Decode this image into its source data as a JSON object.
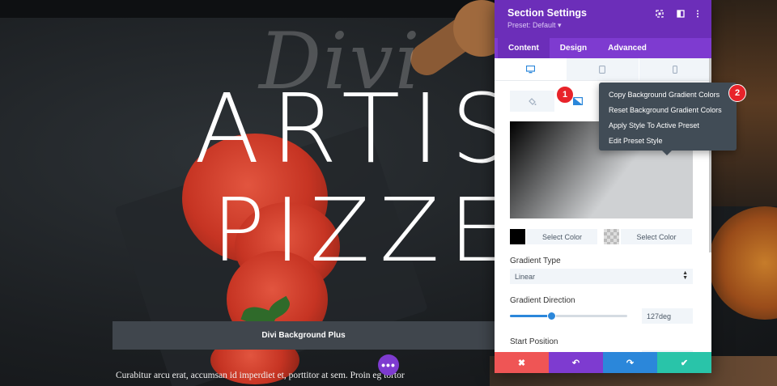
{
  "hero": {
    "script_word": "Divi",
    "title_line1": "ARTISA",
    "title_line2": "PIZZERI/",
    "button_label": "Divi Background Plus",
    "body_text": "Curabitur arcu erat, accumsan id imperdiet et, porttitor at sem. Proin eg  tortor",
    "fab_label": "•••"
  },
  "modal": {
    "title": "Section Settings",
    "preset": "Preset: Default ▾",
    "header_icons": [
      "focus-icon",
      "split-view-icon",
      "more-options-icon"
    ],
    "tabs": [
      {
        "label": "Content",
        "active": true
      },
      {
        "label": "Design",
        "active": false
      },
      {
        "label": "Advanced",
        "active": false
      }
    ],
    "device_tabs": [
      "desktop-icon",
      "tablet-icon",
      "phone-icon"
    ],
    "background_types": [
      "color-fill-icon",
      "gradient-icon"
    ],
    "gradient": {
      "start_color": "#000000",
      "end_color": "transparent",
      "select_color_1": "Select Color",
      "select_color_2": "Select Color",
      "type_label": "Gradient Type",
      "type_value": "Linear",
      "direction_label": "Gradient Direction",
      "direction_value": "127deg",
      "direction_fraction": 0.35,
      "start_position_label": "Start Position"
    }
  },
  "context_menu": {
    "items": [
      "Copy Background Gradient Colors",
      "Reset Background Gradient Colors",
      "Apply Style To Active Preset",
      "Edit Preset Style"
    ]
  },
  "badges": {
    "one": "1",
    "two": "2"
  },
  "footer": {
    "cancel": "✖",
    "undo": "↶",
    "redo": "↷",
    "save": "✔"
  },
  "colors": {
    "brand_purple": "#6c2eb9",
    "tab_purple": "#7e3bd0",
    "cancel_red": "#ef5555",
    "redo_blue": "#2b87da",
    "save_green": "#29c4a9",
    "badge_red": "#e8232a",
    "menu_dark": "#414c56"
  }
}
